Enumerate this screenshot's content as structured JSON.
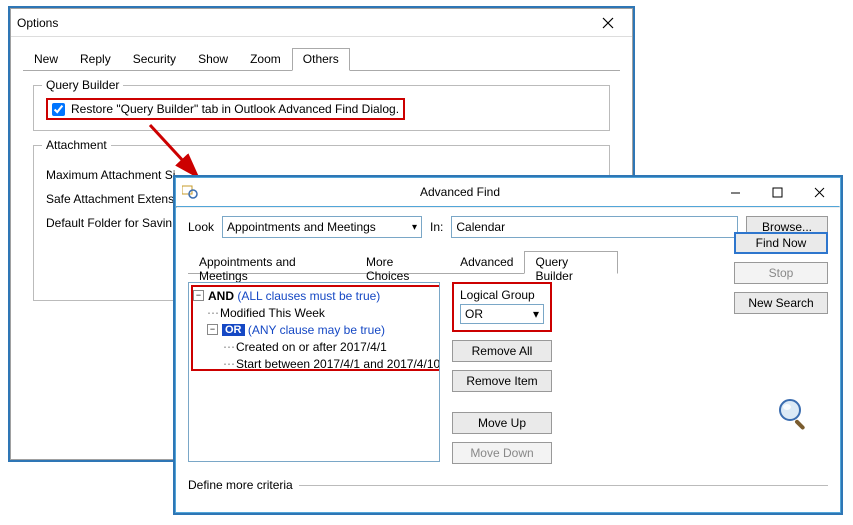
{
  "options": {
    "title": "Options",
    "tabs": [
      "New",
      "Reply",
      "Security",
      "Show",
      "Zoom",
      "Others"
    ],
    "active_tab": 5,
    "query_builder": {
      "legend": "Query Builder",
      "checkbox_label": "Restore \"Query Builder\" tab in Outlook Advanced Find Dialog.",
      "checked": true
    },
    "attachment": {
      "legend": "Attachment",
      "rows": [
        "Maximum Attachment Si",
        "Safe Attachment Extens",
        "Default Folder for Savin"
      ]
    }
  },
  "af": {
    "title": "Advanced Find",
    "look_label": "Look",
    "look_value": "Appointments and Meetings",
    "in_label": "In:",
    "in_value": "Calendar",
    "browse": "Browse...",
    "tabs": [
      "Appointments and Meetings",
      "More Choices",
      "Advanced",
      "Query Builder"
    ],
    "active_tab": 3,
    "tree": {
      "and_label": "AND",
      "and_hint": "(ALL clauses must be true)",
      "clause1": "Modified This Week",
      "or_label": "OR",
      "or_hint": "(ANY clause may be true)",
      "clause2": "Created on or after 2017/4/1",
      "clause3": "Start between 2017/4/1 and 2017/4/10"
    },
    "logical_group": {
      "label": "Logical Group",
      "value": "OR"
    },
    "buttons": {
      "remove_all": "Remove All",
      "remove_item": "Remove Item",
      "move_up": "Move Up",
      "move_down": "Move Down",
      "find_now": "Find Now",
      "stop": "Stop",
      "new_search": "New Search"
    },
    "define_label": "Define more criteria"
  }
}
